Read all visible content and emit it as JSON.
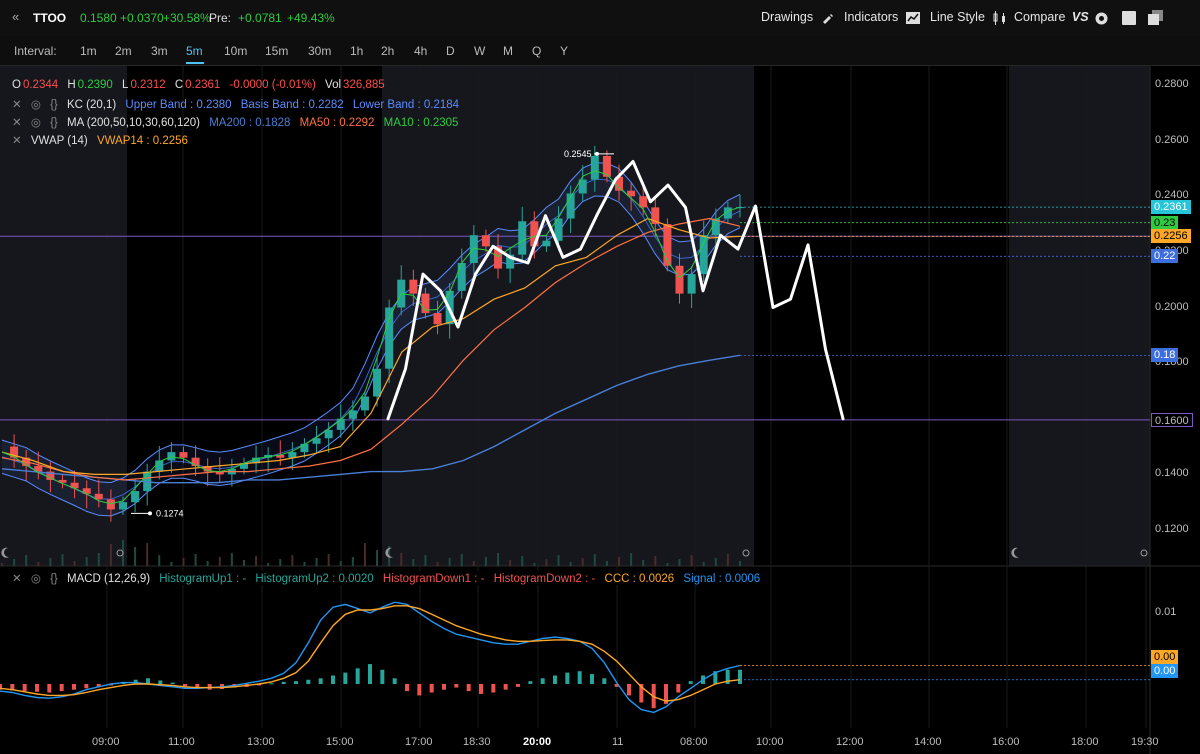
{
  "header": {
    "collapse_icon": "«",
    "symbol": "TTOO",
    "price": "0.1580",
    "change": "+0.0370",
    "change_pct": "+30.58%",
    "pre_label": "Pre:",
    "pre_change": "+0.0781",
    "pre_change_pct": "+49.43%",
    "drawings": "Drawings",
    "indicators": "Indicators",
    "line_style": "Line Style",
    "compare": "Compare",
    "compare_icon": "VS"
  },
  "interval_bar": {
    "label": "Interval:",
    "options": [
      "1m",
      "2m",
      "3m",
      "5m",
      "10m",
      "15m",
      "30m",
      "1h",
      "2h",
      "4h",
      "D",
      "W",
      "M",
      "Q",
      "Y"
    ],
    "active": "5m"
  },
  "legend": {
    "ohlc": {
      "o_label": "O",
      "o": "0.2344",
      "h_label": "H",
      "h": "0.2390",
      "l_label": "L",
      "l": "0.2312",
      "c_label": "C",
      "c": "0.2361",
      "chg": "-0.0000 (-0.01%)",
      "vol_label": "Vol",
      "vol": "326,885"
    },
    "kc": {
      "name": "KC (20,1)",
      "upper": "Upper Band : 0.2380",
      "basis": "Basis Band : 0.2282",
      "lower": "Lower Band : 0.2184"
    },
    "ma": {
      "name": "MA (200,50,10,30,60,120)",
      "ma200": "MA200 : 0.1828",
      "ma50": "MA50 : 0.2292",
      "ma10": "MA10 : 0.2305"
    },
    "vwap": {
      "name": "VWAP (14)",
      "vwap14": "VWAP14 : 0.2256"
    },
    "macd": {
      "name": "MACD (12,26,9)",
      "hu1": "HistogramUp1 : -",
      "hu2": "HistogramUp2 : 0.0020",
      "hd1": "HistogramDown1 : -",
      "hd2": "HistogramDown2 : -",
      "ccc": "CCC : 0.0026",
      "signal": "Signal : 0.0006"
    }
  },
  "colors": {
    "up": "#26a69a",
    "down": "#ef5350",
    "kc": "#5b8cff",
    "ma200": "#4a7fd6",
    "ma50": "#ff7043",
    "ma10": "#2ecc40",
    "vwap": "#ffa726",
    "hline": "#7e57c2",
    "macd_line": "#2196f3",
    "signal_line": "#ffa726",
    "drawing": "#ffffff"
  },
  "chart_data": [
    {
      "type": "candlestick",
      "ylim": [
        0.11,
        0.285
      ],
      "y_ticks": [
        "0.2800",
        "0.2600",
        "0.2400",
        "0.2200",
        "0.2000",
        "0.1800",
        "0.1600",
        "0.1400",
        "0.1200"
      ],
      "y_tick_values": [
        0.28,
        0.26,
        0.24,
        0.22,
        0.2,
        0.18,
        0.16,
        0.14,
        0.12
      ],
      "x_ticks": [
        "09:00",
        "11:00",
        "13:00",
        "15:00",
        "17:00",
        "18:30",
        "20:00",
        "11",
        "08:00",
        "10:00",
        "12:00",
        "14:00",
        "16:00",
        "18:00",
        "19:30"
      ],
      "x_tick_bold": "20:00",
      "annotations": {
        "high": "0.2545",
        "low": "0.1274"
      },
      "high_value": 0.2545,
      "low_value": 0.1274,
      "price_tags": [
        {
          "label": "0.2361",
          "value": 0.2361,
          "color": "#26c6da"
        },
        {
          "label": "0.23",
          "value": 0.2305,
          "color": "#2ecc40"
        },
        {
          "label": "0.2256",
          "value": 0.2256,
          "color": "#ffa726"
        },
        {
          "label": "0.22",
          "value": 0.2184,
          "color": "#3d6ee0"
        },
        {
          "label": "0.18",
          "value": 0.1828,
          "color": "#3d6ee0"
        },
        {
          "label": "0.1600",
          "value": 0.1596,
          "color": "#7e57c2"
        }
      ],
      "horizontal_lines": [
        0.2256,
        0.1596
      ],
      "close_path": [
        0.15,
        0.146,
        0.143,
        0.141,
        0.138,
        0.137,
        0.135,
        0.133,
        0.131,
        0.1274,
        0.13,
        0.134,
        0.141,
        0.145,
        0.148,
        0.146,
        0.143,
        0.141,
        0.14,
        0.142,
        0.144,
        0.146,
        0.147,
        0.146,
        0.148,
        0.151,
        0.153,
        0.156,
        0.16,
        0.163,
        0.168,
        0.178,
        0.2,
        0.21,
        0.205,
        0.198,
        0.194,
        0.206,
        0.216,
        0.226,
        0.222,
        0.214,
        0.219,
        0.231,
        0.222,
        0.224,
        0.232,
        0.241,
        0.246,
        0.2545,
        0.247,
        0.242,
        0.24,
        0.236,
        0.23,
        0.215,
        0.205,
        0.212,
        0.226,
        0.232,
        0.236,
        0.2361
      ],
      "ma200_path": [
        0.142,
        0.141,
        0.14,
        0.139,
        0.138,
        0.137,
        0.137,
        0.137,
        0.138,
        0.138,
        0.139,
        0.14,
        0.141,
        0.141,
        0.142,
        0.145,
        0.15,
        0.156,
        0.162,
        0.167,
        0.172,
        0.176,
        0.179,
        0.181,
        0.1828
      ],
      "ma50_path": [
        0.146,
        0.144,
        0.141,
        0.139,
        0.138,
        0.139,
        0.14,
        0.141,
        0.141,
        0.142,
        0.143,
        0.145,
        0.149,
        0.158,
        0.168,
        0.181,
        0.192,
        0.2,
        0.209,
        0.216,
        0.222,
        0.227,
        0.23,
        0.232,
        0.2292
      ],
      "vwap_path": [
        0.148,
        0.145,
        0.141,
        0.14,
        0.14,
        0.141,
        0.142,
        0.143,
        0.144,
        0.145,
        0.147,
        0.15,
        0.162,
        0.184,
        0.193,
        0.196,
        0.203,
        0.207,
        0.215,
        0.218,
        0.226,
        0.232,
        0.228,
        0.225,
        0.2256
      ],
      "drawing_path": [
        0.16,
        0.178,
        0.212,
        0.206,
        0.193,
        0.212,
        0.222,
        0.218,
        0.216,
        0.233,
        0.218,
        0.221,
        0.234,
        0.246,
        0.2525,
        0.238,
        0.244,
        0.236,
        0.206,
        0.226,
        0.221,
        0.2365,
        0.2,
        0.203,
        0.2225,
        0.185,
        0.16
      ]
    },
    {
      "type": "macd",
      "y_ticks": [
        "0.01",
        "0.00"
      ],
      "y_tick_values": [
        0.01,
        0.0
      ],
      "ylim": [
        -0.0045,
        0.0135
      ],
      "tags": [
        {
          "label": "0.00",
          "value": 0.0026,
          "color": "#ffa726"
        },
        {
          "label": "0.00",
          "value": 0.0006,
          "color": "#2196f3"
        }
      ],
      "histogram": [
        -0.0008,
        -0.0009,
        -0.001,
        -0.0011,
        -0.0012,
        -0.001,
        -0.0008,
        -0.0006,
        -0.0004,
        -0.0002,
        0.0003,
        0.0006,
        0.0008,
        0.0005,
        0.0002,
        -0.0003,
        -0.0006,
        -0.0008,
        -0.0007,
        -0.0005,
        -0.0004,
        -0.0002,
        0.0001,
        0.0003,
        0.0004,
        0.0006,
        0.0008,
        0.0012,
        0.0016,
        0.0022,
        0.0028,
        0.002,
        0.0008,
        -0.001,
        -0.0016,
        -0.0012,
        -0.0008,
        -0.0005,
        -0.001,
        -0.0014,
        -0.0012,
        -0.0008,
        -0.0004,
        0.0004,
        0.0008,
        0.0012,
        0.0016,
        0.0018,
        0.0014,
        0.0008,
        -0.0004,
        -0.0016,
        -0.0026,
        -0.0034,
        -0.0028,
        -0.0012,
        0.0004,
        0.0012,
        0.0018,
        0.002,
        0.002
      ],
      "macd": [
        -0.001,
        -0.0012,
        -0.0016,
        -0.0019,
        -0.002,
        -0.0018,
        -0.0014,
        -0.0008,
        -0.0004,
        0.0,
        0.0002,
        0.0002,
        0.0,
        -0.0002,
        -0.0004,
        -0.0006,
        -0.0006,
        -0.0005,
        -0.0004,
        -0.0002,
        0.0001,
        0.0004,
        0.0008,
        0.0015,
        0.003,
        0.0058,
        0.009,
        0.0108,
        0.0112,
        0.0106,
        0.01,
        0.0108,
        0.0115,
        0.0112,
        0.01,
        0.0088,
        0.0078,
        0.007,
        0.0066,
        0.0062,
        0.0058,
        0.0056,
        0.0056,
        0.006,
        0.0064,
        0.0066,
        0.0064,
        0.006,
        0.005,
        0.003,
        0.0002,
        -0.0022,
        -0.0036,
        -0.004,
        -0.0032,
        -0.0018,
        -0.0006,
        0.0006,
        0.0016,
        0.0022,
        0.0026
      ],
      "signal": [
        -0.0006,
        -0.0008,
        -0.0011,
        -0.0014,
        -0.0016,
        -0.0016,
        -0.0015,
        -0.0012,
        -0.0008,
        -0.0005,
        -0.0002,
        0.0,
        0.0,
        -0.0001,
        -0.0002,
        -0.0004,
        -0.0005,
        -0.0005,
        -0.0005,
        -0.0004,
        -0.0002,
        0.0,
        0.0003,
        0.0008,
        0.0016,
        0.0032,
        0.0058,
        0.0082,
        0.0098,
        0.0104,
        0.0104,
        0.0106,
        0.011,
        0.011,
        0.0106,
        0.0098,
        0.009,
        0.0082,
        0.0076,
        0.007,
        0.0066,
        0.0062,
        0.006,
        0.006,
        0.0061,
        0.0062,
        0.0062,
        0.006,
        0.0056,
        0.0046,
        0.0032,
        0.0014,
        -0.0004,
        -0.0018,
        -0.0024,
        -0.0022,
        -0.0016,
        -0.0008,
        0.0,
        0.0004,
        0.0006
      ]
    }
  ]
}
